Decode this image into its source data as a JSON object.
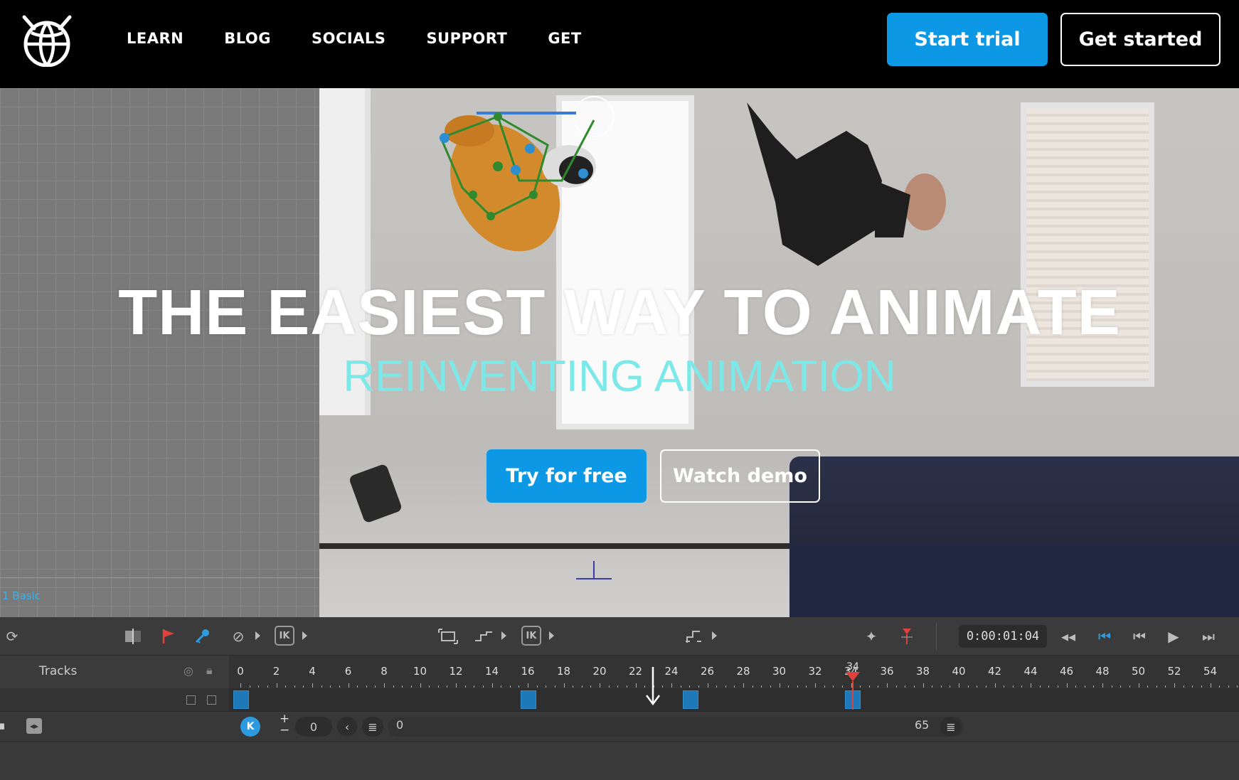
{
  "nav": {
    "links": [
      "LEARN",
      "BLOG",
      "SOCIALS",
      "SUPPORT",
      "GET"
    ],
    "start_trial": "Start trial",
    "get_started": "Get started"
  },
  "hero": {
    "headline": "THE EASIEST WAY TO ANIMATE",
    "subheadline": "REINVENTING ANIMATION",
    "try_free": "Try for free",
    "watch_demo": "Watch demo",
    "grid_label": "1 Basic",
    "subhead_color": "#7de8e8",
    "accent": "#0d98e6"
  },
  "timeline": {
    "time": "0:00:01:04",
    "tracks_label": "Tracks",
    "ruler": [
      "0",
      "2",
      "4",
      "6",
      "8",
      "10",
      "12",
      "14",
      "16",
      "18",
      "20",
      "22",
      "24",
      "26",
      "28",
      "30",
      "32",
      "34",
      "36",
      "38",
      "40",
      "42",
      "44",
      "46",
      "48",
      "50",
      "52",
      "54"
    ],
    "current_frame": "34",
    "start_value": "0",
    "range_start": "0",
    "range_end": "65",
    "toolbar_icons": [
      "refresh-icon",
      "mirror-icon",
      "flag-icon",
      "key-icon",
      "ban-icon",
      "ik-icon",
      "frame-icon",
      "step-curve-icon",
      "ik-icon",
      "bounce-icon",
      "pin-icon",
      "marker-icon",
      "rewind-icon",
      "go-start-icon",
      "prev-frame-icon",
      "play-icon",
      "next-frame-icon"
    ]
  }
}
